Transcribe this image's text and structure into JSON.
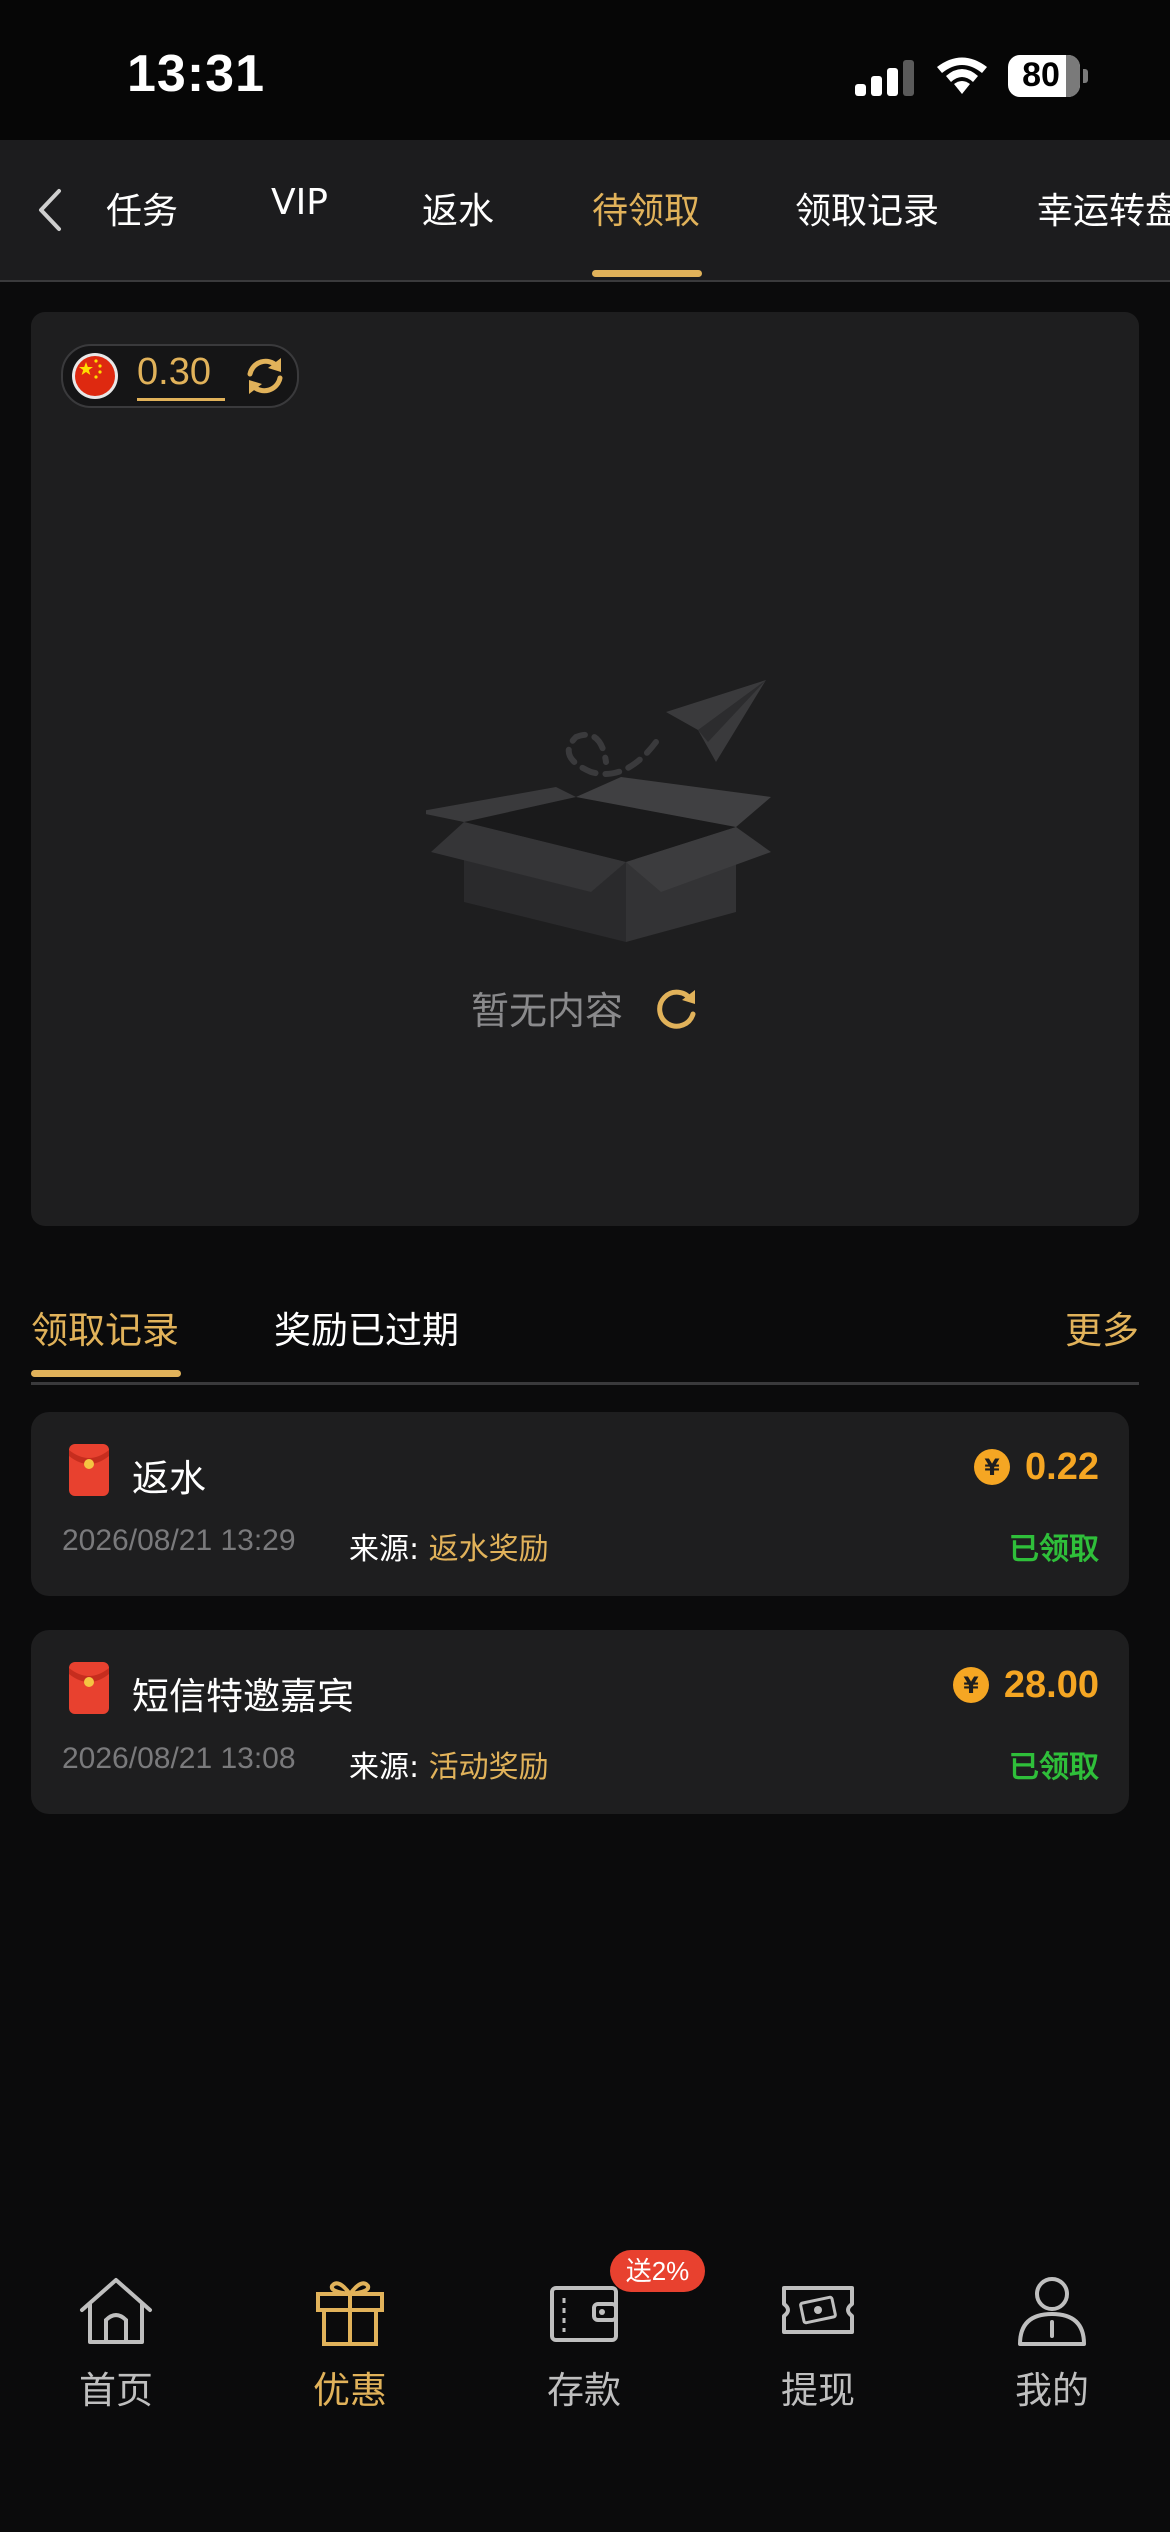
{
  "status_bar": {
    "time": "13:31",
    "battery": "80"
  },
  "top_tabs": {
    "items": [
      {
        "label": "任务"
      },
      {
        "label": "VIP"
      },
      {
        "label": "返水"
      },
      {
        "label": "待领取"
      },
      {
        "label": "领取记录"
      },
      {
        "label": "幸运转盘"
      }
    ],
    "active": "待领取"
  },
  "balance": {
    "value": "0.30",
    "flag_icon": "china-flag-icon",
    "refresh_icon": "refresh-icon"
  },
  "empty_state": {
    "text": "暂无内容"
  },
  "records_tabs": {
    "tab_claimed": "领取记录",
    "tab_expired": "奖励已过期",
    "more": "更多"
  },
  "records": [
    {
      "title": "返水",
      "amount": "0.22",
      "time": "2026/08/21 13:29",
      "source_label": "来源:",
      "source_value": "返水奖励",
      "status": "已领取"
    },
    {
      "title": "短信特邀嘉宾",
      "amount": "28.00",
      "time": "2026/08/21 13:08",
      "source_label": "来源:",
      "source_value": "活动奖励",
      "status": "已领取"
    }
  ],
  "bottom_nav": {
    "items": [
      {
        "label": "首页",
        "icon": "home-icon"
      },
      {
        "label": "优惠",
        "icon": "gift-icon"
      },
      {
        "label": "存款",
        "icon": "wallet-icon"
      },
      {
        "label": "提现",
        "icon": "cash-icon"
      },
      {
        "label": "我的",
        "icon": "user-icon"
      }
    ],
    "badge": "送2%"
  },
  "colors": {
    "accent": "#e1b25a",
    "amount": "#f5a623",
    "status_claimed": "#2fbf3a",
    "badge": "#e8412f",
    "card": "#1e1e1f",
    "background": "#0b0b0c"
  }
}
